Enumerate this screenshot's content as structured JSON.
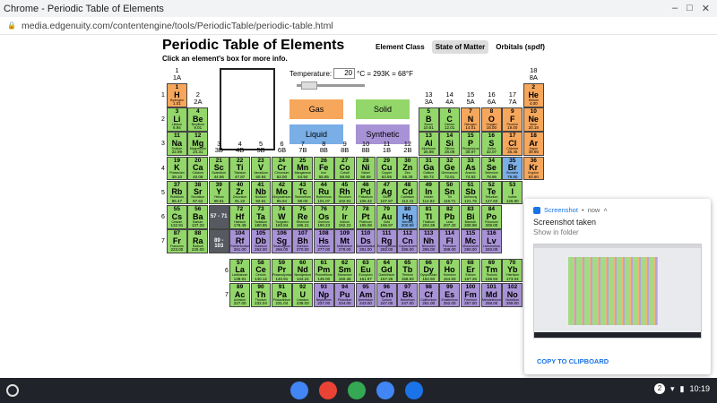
{
  "window": {
    "title": "Chrome - Periodic Table of Elements",
    "url": "media.edgenuity.com/contentengine/tools/PeriodicTable/periodic-table.html"
  },
  "page": {
    "title": "Periodic Table of Elements",
    "subtitle": "Click an element's box for more info.",
    "tabs": [
      "Element Class",
      "State of Matter",
      "Orbitals (spdf)"
    ],
    "active_tab": "State of Matter"
  },
  "temperature": {
    "label": "Temperature:",
    "value": "20",
    "suffix": "°C = 293K = 68°F"
  },
  "legend": {
    "gas": "Gas",
    "solid": "Solid",
    "liquid": "Liquid",
    "synthetic": "Synthetic"
  },
  "colors": {
    "gas": "#f6a75c",
    "solid": "#93d66a",
    "liquid": "#7aaee6",
    "synthetic": "#a892d6",
    "marker": "#565a60"
  },
  "markers": [
    "57 - 71",
    "89 - 103"
  ],
  "groups": [
    [
      "1",
      "1A"
    ],
    [
      "2",
      "2A"
    ],
    [
      "3",
      "3B"
    ],
    [
      "4",
      "4B"
    ],
    [
      "5",
      "5B"
    ],
    [
      "6",
      "6B"
    ],
    [
      "7",
      "7B"
    ],
    [
      "8",
      "8B"
    ],
    [
      "9",
      "8B"
    ],
    [
      "10",
      "8B"
    ],
    [
      "11",
      "1B"
    ],
    [
      "12",
      "2B"
    ],
    [
      "13",
      "3A"
    ],
    [
      "14",
      "4A"
    ],
    [
      "15",
      "5A"
    ],
    [
      "16",
      "6A"
    ],
    [
      "17",
      "7A"
    ],
    [
      "18",
      "8A"
    ]
  ],
  "periods": [
    "1",
    "2",
    "3",
    "4",
    "5",
    "6",
    "7"
  ],
  "series_labels": [
    "6",
    "7"
  ],
  "elements": [
    [
      1,
      "H",
      "Hydrogen",
      "1.01",
      1,
      1,
      "g"
    ],
    [
      2,
      "He",
      "Helium",
      "4.00",
      18,
      1,
      "g"
    ],
    [
      3,
      "Li",
      "Lithium",
      "6.94",
      1,
      2,
      "s"
    ],
    [
      4,
      "Be",
      "Beryllium",
      "9.01",
      2,
      2,
      "s"
    ],
    [
      5,
      "B",
      "Boron",
      "10.81",
      13,
      2,
      "s"
    ],
    [
      6,
      "C",
      "Carbon",
      "12.01",
      14,
      2,
      "s"
    ],
    [
      7,
      "N",
      "Nitrogen",
      "14.01",
      15,
      2,
      "g"
    ],
    [
      8,
      "O",
      "Oxygen",
      "16.00",
      16,
      2,
      "g"
    ],
    [
      9,
      "F",
      "Fluorine",
      "19.00",
      17,
      2,
      "g"
    ],
    [
      10,
      "Ne",
      "Neon",
      "20.18",
      18,
      2,
      "g"
    ],
    [
      11,
      "Na",
      "Sodium",
      "22.99",
      1,
      3,
      "s"
    ],
    [
      12,
      "Mg",
      "Magnesium",
      "24.31",
      2,
      3,
      "s"
    ],
    [
      13,
      "Al",
      "Aluminum",
      "26.98",
      13,
      3,
      "s"
    ],
    [
      14,
      "Si",
      "Silicon",
      "28.09",
      14,
      3,
      "s"
    ],
    [
      15,
      "P",
      "Phosphorus",
      "30.97",
      15,
      3,
      "s"
    ],
    [
      16,
      "S",
      "Sulfur",
      "32.07",
      16,
      3,
      "s"
    ],
    [
      17,
      "Cl",
      "Chlorine",
      "35.45",
      17,
      3,
      "g"
    ],
    [
      18,
      "Ar",
      "Argon",
      "39.95",
      18,
      3,
      "g"
    ],
    [
      19,
      "K",
      "Potassium",
      "39.10",
      1,
      4,
      "s"
    ],
    [
      20,
      "Ca",
      "Calcium",
      "40.08",
      2,
      4,
      "s"
    ],
    [
      21,
      "Sc",
      "Scandium",
      "44.96",
      3,
      4,
      "s"
    ],
    [
      22,
      "Ti",
      "Titanium",
      "47.87",
      4,
      4,
      "s"
    ],
    [
      23,
      "V",
      "Vanadium",
      "50.94",
      5,
      4,
      "s"
    ],
    [
      24,
      "Cr",
      "Chromium",
      "52.00",
      6,
      4,
      "s"
    ],
    [
      25,
      "Mn",
      "Manganese",
      "54.94",
      7,
      4,
      "s"
    ],
    [
      26,
      "Fe",
      "Iron",
      "55.85",
      8,
      4,
      "s"
    ],
    [
      27,
      "Co",
      "Cobalt",
      "58.93",
      9,
      4,
      "s"
    ],
    [
      28,
      "Ni",
      "Nickel",
      "58.69",
      10,
      4,
      "s"
    ],
    [
      29,
      "Cu",
      "Copper",
      "63.55",
      11,
      4,
      "s"
    ],
    [
      30,
      "Zn",
      "Zinc",
      "65.39",
      12,
      4,
      "s"
    ],
    [
      31,
      "Ga",
      "Gallium",
      "69.72",
      13,
      4,
      "s"
    ],
    [
      32,
      "Ge",
      "Germanium",
      "72.61",
      14,
      4,
      "s"
    ],
    [
      33,
      "As",
      "Arsenic",
      "74.92",
      15,
      4,
      "s"
    ],
    [
      34,
      "Se",
      "Selenium",
      "78.96",
      16,
      4,
      "s"
    ],
    [
      35,
      "Br",
      "Bromine",
      "79.90",
      17,
      4,
      "l"
    ],
    [
      36,
      "Kr",
      "Krypton",
      "83.80",
      18,
      4,
      "g"
    ],
    [
      37,
      "Rb",
      "Rubidium",
      "85.47",
      1,
      5,
      "s"
    ],
    [
      38,
      "Sr",
      "Strontium",
      "87.62",
      2,
      5,
      "s"
    ],
    [
      39,
      "Y",
      "Yttrium",
      "88.91",
      3,
      5,
      "s"
    ],
    [
      40,
      "Zr",
      "Zirconium",
      "91.22",
      4,
      5,
      "s"
    ],
    [
      41,
      "Nb",
      "Niobium",
      "92.91",
      5,
      5,
      "s"
    ],
    [
      42,
      "Mo",
      "Molybdenum",
      "95.94",
      6,
      5,
      "s"
    ],
    [
      43,
      "Tc",
      "Technetium",
      "98.00",
      7,
      5,
      "s"
    ],
    [
      44,
      "Ru",
      "Ruthenium",
      "101.07",
      8,
      5,
      "s"
    ],
    [
      45,
      "Rh",
      "Rhodium",
      "102.91",
      9,
      5,
      "s"
    ],
    [
      46,
      "Pd",
      "Palladium",
      "106.42",
      10,
      5,
      "s"
    ],
    [
      47,
      "Ag",
      "Silver",
      "107.87",
      11,
      5,
      "s"
    ],
    [
      48,
      "Cd",
      "Cadmium",
      "112.41",
      12,
      5,
      "s"
    ],
    [
      49,
      "In",
      "Indium",
      "114.82",
      13,
      5,
      "s"
    ],
    [
      50,
      "Sn",
      "Tin",
      "118.71",
      14,
      5,
      "s"
    ],
    [
      51,
      "Sb",
      "Antimony",
      "121.76",
      15,
      5,
      "s"
    ],
    [
      52,
      "Te",
      "Tellurium",
      "127.60",
      16,
      5,
      "s"
    ],
    [
      53,
      "I",
      "Iodine",
      "126.90",
      17,
      5,
      "s"
    ],
    [
      55,
      "Cs",
      "Cesium",
      "132.91",
      1,
      6,
      "s"
    ],
    [
      56,
      "Ba",
      "Barium",
      "137.33",
      2,
      6,
      "s"
    ],
    [
      72,
      "Hf",
      "Hafnium",
      "178.49",
      4,
      6,
      "s"
    ],
    [
      73,
      "Ta",
      "Tantalum",
      "180.95",
      5,
      6,
      "s"
    ],
    [
      74,
      "W",
      "Tungsten",
      "183.84",
      6,
      6,
      "s"
    ],
    [
      75,
      "Re",
      "Rhenium",
      "186.21",
      7,
      6,
      "s"
    ],
    [
      76,
      "Os",
      "Osmium",
      "190.23",
      8,
      6,
      "s"
    ],
    [
      77,
      "Ir",
      "Iridium",
      "192.22",
      9,
      6,
      "s"
    ],
    [
      78,
      "Pt",
      "Platinum",
      "195.08",
      10,
      6,
      "s"
    ],
    [
      79,
      "Au",
      "Gold",
      "196.97",
      11,
      6,
      "s"
    ],
    [
      80,
      "Hg",
      "Mercury",
      "200.59",
      12,
      6,
      "l"
    ],
    [
      81,
      "Tl",
      "Thallium",
      "204.38",
      13,
      6,
      "s"
    ],
    [
      82,
      "Pb",
      "Lead",
      "207.20",
      14,
      6,
      "s"
    ],
    [
      83,
      "Bi",
      "Bismuth",
      "208.98",
      15,
      6,
      "s"
    ],
    [
      84,
      "Po",
      "Polonium",
      "209.00",
      16,
      6,
      "s"
    ],
    [
      87,
      "Fr",
      "Francium",
      "223.00",
      1,
      7,
      "s"
    ],
    [
      88,
      "Ra",
      "Radium",
      "226.00",
      2,
      7,
      "s"
    ],
    [
      104,
      "Rf",
      "Rutherfordium",
      "261.00",
      4,
      7,
      "y"
    ],
    [
      105,
      "Db",
      "Dubnium",
      "262.00",
      5,
      7,
      "y"
    ],
    [
      106,
      "Sg",
      "Seaborgium",
      "266.00",
      6,
      7,
      "y"
    ],
    [
      107,
      "Bh",
      "Bohrium",
      "270.00",
      7,
      7,
      "y"
    ],
    [
      108,
      "Hs",
      "Hassium",
      "277.00",
      8,
      7,
      "y"
    ],
    [
      109,
      "Mt",
      "Meitnerium",
      "278.00",
      9,
      7,
      "y"
    ],
    [
      110,
      "Ds",
      "Darmstadtium",
      "281.00",
      10,
      7,
      "y"
    ],
    [
      111,
      "Rg",
      "Roentgenium",
      "282.00",
      11,
      7,
      "y"
    ],
    [
      112,
      "Cn",
      "Copernicium",
      "285.00",
      12,
      7,
      "y"
    ],
    [
      113,
      "Nh",
      "Nihonium",
      "286.00",
      13,
      7,
      "y"
    ],
    [
      114,
      "Fl",
      "Flerovium",
      "289.00",
      14,
      7,
      "y"
    ],
    [
      115,
      "Mc",
      "Moscovium",
      "290.00",
      15,
      7,
      "y"
    ],
    [
      116,
      "Lv",
      "Livermorium",
      "293.00",
      16,
      7,
      "y"
    ],
    [
      57,
      "La",
      "Lanthanum",
      "138.91",
      4,
      9,
      "s"
    ],
    [
      58,
      "Ce",
      "Cerium",
      "140.12",
      5,
      9,
      "s"
    ],
    [
      59,
      "Pr",
      "Praseodymium",
      "140.91",
      6,
      9,
      "s"
    ],
    [
      60,
      "Nd",
      "Neodymium",
      "144.24",
      7,
      9,
      "s"
    ],
    [
      61,
      "Pm",
      "Promethium",
      "145.00",
      8,
      9,
      "s"
    ],
    [
      62,
      "Sm",
      "Samarium",
      "150.36",
      9,
      9,
      "s"
    ],
    [
      63,
      "Eu",
      "Europium",
      "151.97",
      10,
      9,
      "s"
    ],
    [
      64,
      "Gd",
      "Gadolinium",
      "157.25",
      11,
      9,
      "s"
    ],
    [
      65,
      "Tb",
      "Terbium",
      "158.93",
      12,
      9,
      "s"
    ],
    [
      66,
      "Dy",
      "Dysprosium",
      "162.50",
      13,
      9,
      "s"
    ],
    [
      67,
      "Ho",
      "Holmium",
      "164.93",
      14,
      9,
      "s"
    ],
    [
      68,
      "Er",
      "Erbium",
      "167.26",
      15,
      9,
      "s"
    ],
    [
      69,
      "Tm",
      "Thulium",
      "168.93",
      16,
      9,
      "s"
    ],
    [
      70,
      "Yb",
      "Ytterbium",
      "173.04",
      17,
      9,
      "s"
    ],
    [
      89,
      "Ac",
      "Actinium",
      "227.00",
      4,
      10,
      "s"
    ],
    [
      90,
      "Th",
      "Thorium",
      "232.04",
      5,
      10,
      "s"
    ],
    [
      91,
      "Pa",
      "Protactinium",
      "231.04",
      6,
      10,
      "s"
    ],
    [
      92,
      "U",
      "Uranium",
      "238.03",
      7,
      10,
      "s"
    ],
    [
      93,
      "Np",
      "Neptunium",
      "237.00",
      8,
      10,
      "y"
    ],
    [
      94,
      "Pu",
      "Plutonium",
      "244.00",
      9,
      10,
      "y"
    ],
    [
      95,
      "Am",
      "Americium",
      "243.00",
      10,
      10,
      "y"
    ],
    [
      96,
      "Cm",
      "Curium",
      "247.00",
      11,
      10,
      "y"
    ],
    [
      97,
      "Bk",
      "Berkelium",
      "247.00",
      12,
      10,
      "y"
    ],
    [
      98,
      "Cf",
      "Californium",
      "251.00",
      13,
      10,
      "y"
    ],
    [
      99,
      "Es",
      "Einsteinium",
      "252.00",
      14,
      10,
      "y"
    ],
    [
      100,
      "Fm",
      "Fermium",
      "257.00",
      15,
      10,
      "y"
    ],
    [
      101,
      "Md",
      "Mendelevium",
      "258.00",
      16,
      10,
      "y"
    ],
    [
      102,
      "No",
      "Nobelium",
      "259.00",
      17,
      10,
      "y"
    ]
  ],
  "notification": {
    "app": "Screenshot",
    "time": "now",
    "title": "Screenshot taken",
    "body": "Show in folder",
    "action": "COPY TO CLIPBOARD"
  },
  "shelf": {
    "apps": [
      "chrome-icon",
      "gmail-icon",
      "play-store-icon",
      "docs-icon",
      "messages-icon"
    ],
    "badge": "2",
    "time": "10:19"
  }
}
